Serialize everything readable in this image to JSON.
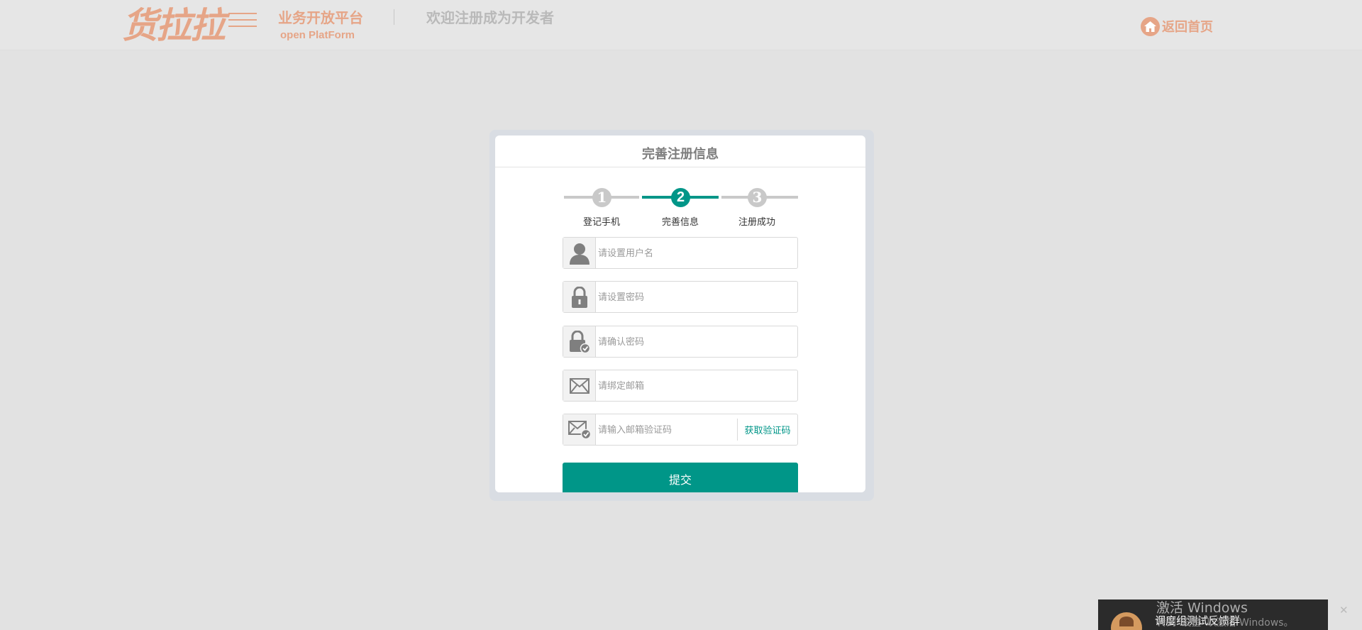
{
  "header": {
    "logo_text": "货拉拉",
    "platform_title": "业务开放平台",
    "platform_sub": "open PlatForm",
    "welcome": "欢迎注册成为开发者",
    "home_link": "返回首页",
    "home_icon": "home-icon"
  },
  "card": {
    "title": "完善注册信息",
    "steps": [
      {
        "number": "1",
        "label": "登记手机",
        "state": "done"
      },
      {
        "number": "2",
        "label": "完善信息",
        "state": "active"
      },
      {
        "number": "3",
        "label": "注册成功",
        "state": "pending"
      }
    ],
    "fields": {
      "username": {
        "placeholder": "请设置用户名",
        "value": "",
        "icon": "user-icon"
      },
      "password": {
        "placeholder": "请设置密码",
        "value": "",
        "icon": "lock-icon"
      },
      "confirm_password": {
        "placeholder": "请确认密码",
        "value": "",
        "icon": "lock-check-icon"
      },
      "email": {
        "placeholder": "请绑定邮箱",
        "value": "",
        "icon": "mail-icon"
      },
      "email_code": {
        "placeholder": "请输入邮箱验证码",
        "value": "",
        "icon": "mail-check-icon",
        "action_label": "获取验证码"
      }
    },
    "submit_label": "提交"
  },
  "overlay": {
    "notification_text": "调度组测试反馈群",
    "watermark_title": "激活 Windows",
    "watermark_sub": "转到“设置”以激活 Windows。"
  },
  "colors": {
    "accent": "#009688",
    "brand": "#e6a587",
    "background": "#e2e2e2",
    "step_inactive": "#c9c9c9"
  }
}
